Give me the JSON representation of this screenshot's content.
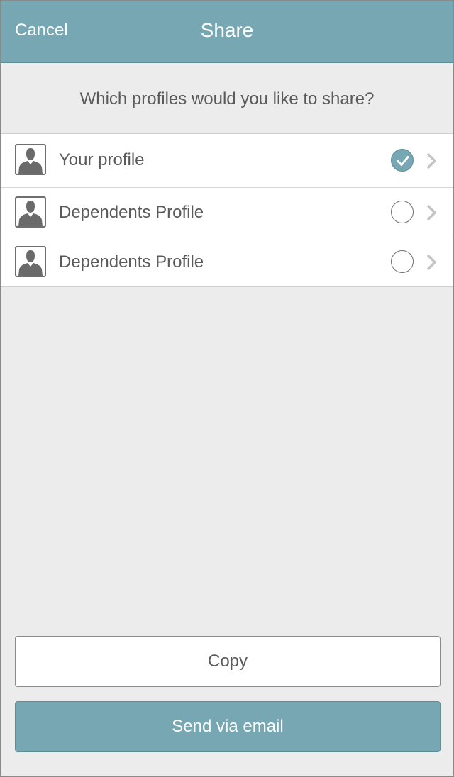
{
  "navbar": {
    "cancel_label": "Cancel",
    "title": "Share"
  },
  "prompt": "Which profiles would you like to share?",
  "profiles": [
    {
      "label": "Your profile",
      "icon": "person-silhouette-icon",
      "selected": true
    },
    {
      "label": "Dependents Profile",
      "icon": "person-silhouette-icon",
      "selected": false
    },
    {
      "label": "Dependents Profile",
      "icon": "person-silhouette-icon",
      "selected": false
    }
  ],
  "actions": {
    "copy_label": "Copy",
    "email_label": "Send via email"
  },
  "colors": {
    "accent": "#77a7b2",
    "text": "#5a5a5a",
    "background": "#ececec"
  }
}
